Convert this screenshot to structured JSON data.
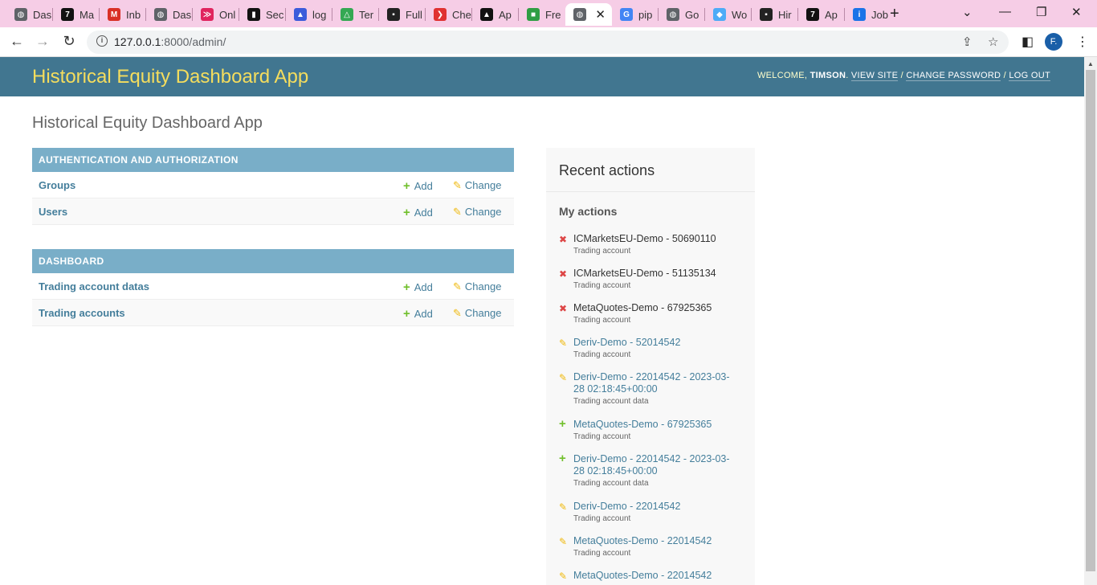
{
  "browser": {
    "tabs": [
      {
        "label": "Das",
        "icon": "globe-icon",
        "color": "#5f6368"
      },
      {
        "label": "Ma",
        "icon": "medium-icon",
        "color": "#111111"
      },
      {
        "label": "Inb",
        "icon": "gmail-icon",
        "color": "#d93025"
      },
      {
        "label": "Das",
        "icon": "globe-icon",
        "color": "#5f6368"
      },
      {
        "label": "Onl",
        "icon": "app-icon",
        "color": "#e0245e"
      },
      {
        "label": "Sec",
        "icon": "chart-icon",
        "color": "#111111"
      },
      {
        "label": "log",
        "icon": "graduation-icon",
        "color": "#3b5bdb"
      },
      {
        "label": "Ter",
        "icon": "drive-icon",
        "color": "#34a853"
      },
      {
        "label": "Full",
        "icon": "square-icon",
        "color": "#222222"
      },
      {
        "label": "Che",
        "icon": "arrow-icon",
        "color": "#e03131"
      },
      {
        "label": "Ap",
        "icon": "triangle-icon",
        "color": "#111111"
      },
      {
        "label": "Fre",
        "icon": "chat-icon",
        "color": "#2f9e44"
      },
      {
        "label": "",
        "icon": "globe-icon",
        "color": "#5f6368",
        "active": true
      },
      {
        "label": "pip",
        "icon": "google-icon",
        "color": "#4285f4"
      },
      {
        "label": "Go",
        "icon": "globe-icon",
        "color": "#5f6368"
      },
      {
        "label": "Wo",
        "icon": "cube-icon",
        "color": "#4dabf7"
      },
      {
        "label": "Hir",
        "icon": "square-icon",
        "color": "#222222"
      },
      {
        "label": "Ap",
        "icon": "medium-icon",
        "color": "#111111"
      },
      {
        "label": "Job",
        "icon": "info-icon",
        "color": "#1a73e8"
      }
    ],
    "url_host": "127.0.0.1",
    "url_rest": ":8000/admin/",
    "profile_initial": "F."
  },
  "admin": {
    "site_title": "Historical Equity Dashboard App",
    "welcome": "WELCOME,",
    "username": "TIMSON",
    "view_site": "VIEW SITE",
    "change_password": "CHANGE PASSWORD",
    "log_out": "LOG OUT",
    "page_title": "Historical Equity Dashboard App",
    "add_label": "Add",
    "change_label": "Change",
    "modules": [
      {
        "caption": "AUTHENTICATION AND AUTHORIZATION",
        "models": [
          "Groups",
          "Users"
        ]
      },
      {
        "caption": "DASHBOARD",
        "models": [
          "Trading account datas",
          "Trading accounts"
        ]
      }
    ],
    "recent_title": "Recent actions",
    "my_actions_title": "My actions",
    "actions": [
      {
        "type": "deletion",
        "label": "ICMarketsEU-Demo - 50690110",
        "kind": "Trading account"
      },
      {
        "type": "deletion",
        "label": "ICMarketsEU-Demo - 51135134",
        "kind": "Trading account"
      },
      {
        "type": "deletion",
        "label": "MetaQuotes-Demo - 67925365",
        "kind": "Trading account"
      },
      {
        "type": "change",
        "label": "Deriv-Demo - 52014542",
        "kind": "Trading account"
      },
      {
        "type": "change",
        "label": "Deriv-Demo - 22014542 - 2023-03-28 02:18:45+00:00",
        "kind": "Trading account data"
      },
      {
        "type": "addition",
        "label": "MetaQuotes-Demo - 67925365",
        "kind": "Trading account"
      },
      {
        "type": "addition",
        "label": "Deriv-Demo - 22014542 - 2023-03-28 02:18:45+00:00",
        "kind": "Trading account data"
      },
      {
        "type": "change",
        "label": "Deriv-Demo - 22014542",
        "kind": "Trading account"
      },
      {
        "type": "change",
        "label": "MetaQuotes-Demo - 22014542",
        "kind": "Trading account"
      },
      {
        "type": "change",
        "label": "MetaQuotes-Demo - 22014542",
        "kind": ""
      }
    ]
  }
}
